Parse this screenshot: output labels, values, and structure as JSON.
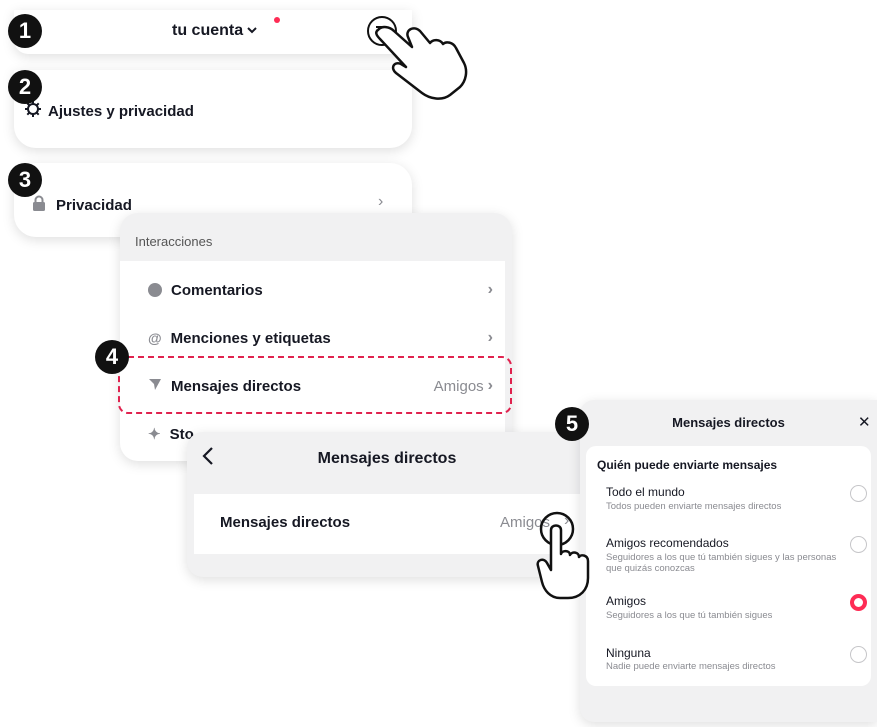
{
  "steps": [
    "1",
    "2",
    "3",
    "4",
    "5"
  ],
  "panel1": {
    "account_label": "tu cuenta",
    "chevron": "⌄"
  },
  "panel2": {
    "settings_label": "Ajustes y privacidad"
  },
  "panel3": {
    "privacy_label": "Privacidad"
  },
  "panel4": {
    "section_title": "Interacciones",
    "items": [
      {
        "label": "Comentarios",
        "value": ""
      },
      {
        "label": "Menciones y etiquetas",
        "value": ""
      },
      {
        "label": "Mensajes directos",
        "value": "Amigos"
      },
      {
        "label": "Sto",
        "value": ""
      }
    ]
  },
  "panel5": {
    "title": "Mensajes directos",
    "row_label": "Mensajes directos",
    "row_value": "Amigos"
  },
  "panel6": {
    "title": "Mensajes directos",
    "close": "✕",
    "subtitle": "Quién puede enviarte mensajes",
    "options": [
      {
        "label": "Todo el mundo",
        "desc": "Todos pueden enviarte mensajes directos",
        "selected": false
      },
      {
        "label": "Amigos recomendados",
        "desc": "Seguidores a los que tú también sigues y las personas",
        "desc2": "que quizás conozcas",
        "selected": false
      },
      {
        "label": "Amigos",
        "desc": "Seguidores a los que tú también sigues",
        "selected": true
      },
      {
        "label": "Ninguna",
        "desc": "Nadie puede enviarte mensajes directos",
        "selected": false
      }
    ]
  },
  "colors": {
    "accent": "#fe2c55",
    "text": "#161823",
    "muted": "#8a8b91",
    "dash": "#e0234f"
  }
}
